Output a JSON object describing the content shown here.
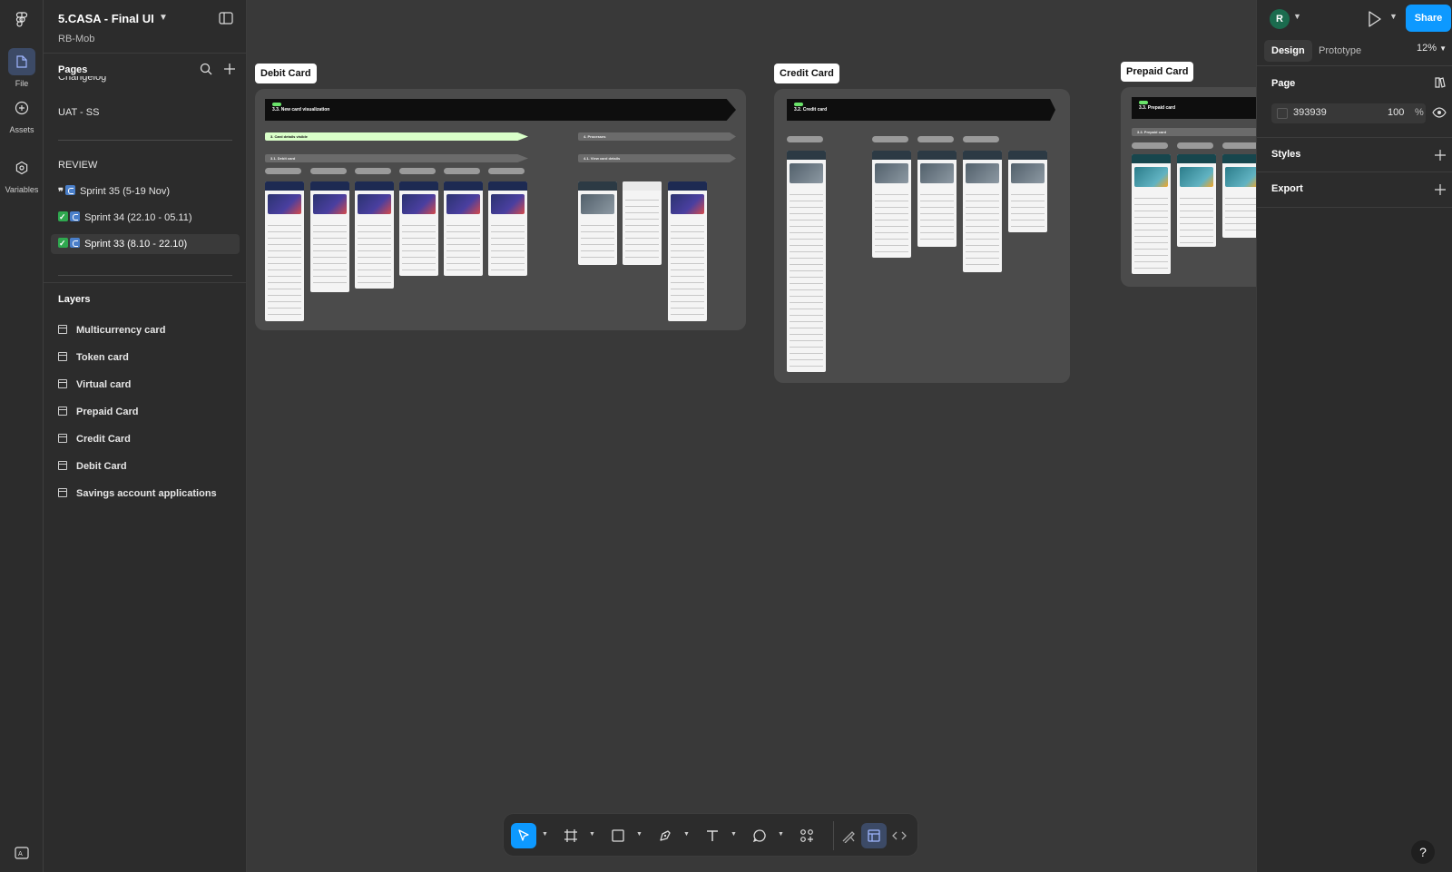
{
  "rail": {
    "items": [
      {
        "label": "File",
        "icon": "file-icon"
      },
      {
        "label": "Assets",
        "icon": "assets-icon"
      },
      {
        "label": "Variables",
        "icon": "variables-icon"
      }
    ]
  },
  "file": {
    "title": "5.CASA - Final UI",
    "team": "RB-Mob"
  },
  "pages": {
    "header": "Pages",
    "partial_item": "Changelog",
    "items": [
      "UAT - SS"
    ],
    "review_header": "REVIEW",
    "sprints": [
      {
        "prefix": "👀",
        "label": "Sprint 35 (5-19 Nov)"
      },
      {
        "prefix": "✅",
        "label": "Sprint 34 (22.10 - 05.11)"
      },
      {
        "prefix": "✅",
        "label": "Sprint 33 (8.10 - 22.10)"
      }
    ]
  },
  "layers": {
    "header": "Layers",
    "items": [
      "Multicurrency card",
      "Token card",
      "Virtual card",
      "Prepaid Card",
      "Credit Card",
      "Debit Card",
      "Savings account applications"
    ]
  },
  "canvas": {
    "frames": [
      {
        "label": "Debit Card",
        "banner": "3.3. New card visualization",
        "section1": "3. Card details visible",
        "section2": "3.1. Debit card",
        "section3": "4. Processes",
        "section4": "4.1. View card details"
      },
      {
        "label": "Credit Card",
        "banner": "3.2. Credit card"
      },
      {
        "label": "Prepaid Card",
        "banner": "3.3. Prepaid card",
        "section2": "3.3. Prepaid card"
      }
    ]
  },
  "right": {
    "avatar": "R",
    "share": "Share",
    "tabs": [
      "Design",
      "Prototype"
    ],
    "zoom": "12%",
    "page_section": "Page",
    "page_color": "393939",
    "page_opacity": "100",
    "percent": "%",
    "styles": "Styles",
    "export": "Export",
    "help": "?"
  },
  "colors": {
    "accent": "#0d99ff",
    "canvas": "#393939",
    "panel": "#2c2c2c"
  }
}
